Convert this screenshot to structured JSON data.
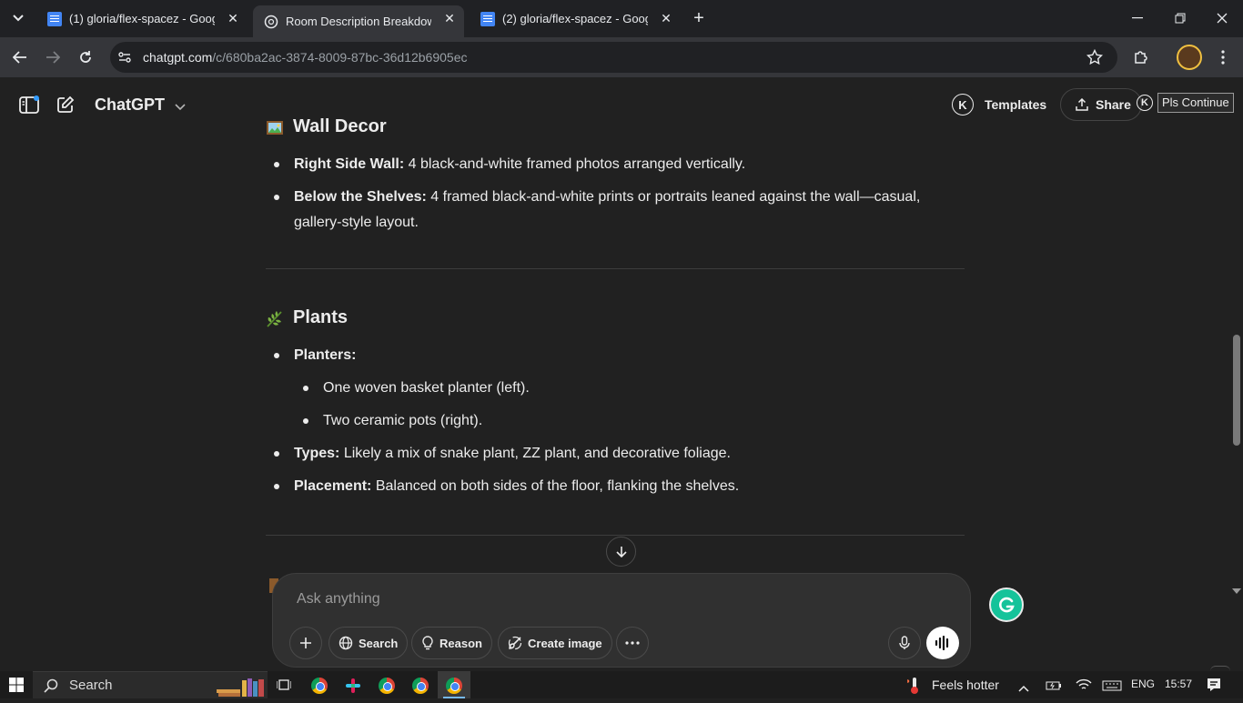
{
  "browser": {
    "tabs": [
      {
        "title": "(1) gloria/flex-spacez - Google D",
        "active": false
      },
      {
        "title": "Room Description Breakdown",
        "active": true
      },
      {
        "title": "(2) gloria/flex-spacez - Google D",
        "active": false
      }
    ],
    "url_host": "chatgpt.com",
    "url_path": "/c/680ba2ac-3874-8009-87bc-36d12b6905ec"
  },
  "header": {
    "brand": "ChatGPT",
    "templates_label": "Templates",
    "share_label": "Share",
    "extension_letter": "K",
    "pls_continue_label": "Pls Continue"
  },
  "sections": {
    "wall_decor": {
      "heading": "Wall Decor",
      "items": [
        {
          "label": "Right Side Wall:",
          "text": " 4 black-and-white framed photos arranged vertically."
        },
        {
          "label": "Below the Shelves:",
          "text": " 4 framed black-and-white prints or portraits leaned against the wall—casual, gallery-style layout."
        }
      ]
    },
    "plants": {
      "heading": "Plants",
      "planters_label": "Planters:",
      "planters": [
        "One woven basket planter (left).",
        "Two ceramic pots (right)."
      ],
      "types_label": "Types:",
      "types_text": " Likely a mix of snake plant, ZZ plant, and decorative foliage.",
      "placement_label": "Placement:",
      "placement_text": " Balanced on both sides of the floor, flanking the shelves."
    }
  },
  "composer": {
    "placeholder": "Ask anything",
    "search_label": "Search",
    "reason_label": "Reason",
    "create_image_label": "Create image"
  },
  "taskbar": {
    "search_label": "Search",
    "weather_text": "Feels hotter",
    "language": "ENG",
    "time": "15:57"
  },
  "colors": {
    "background": "#212121",
    "composer": "#303030",
    "grammarly": "#15c39a"
  }
}
